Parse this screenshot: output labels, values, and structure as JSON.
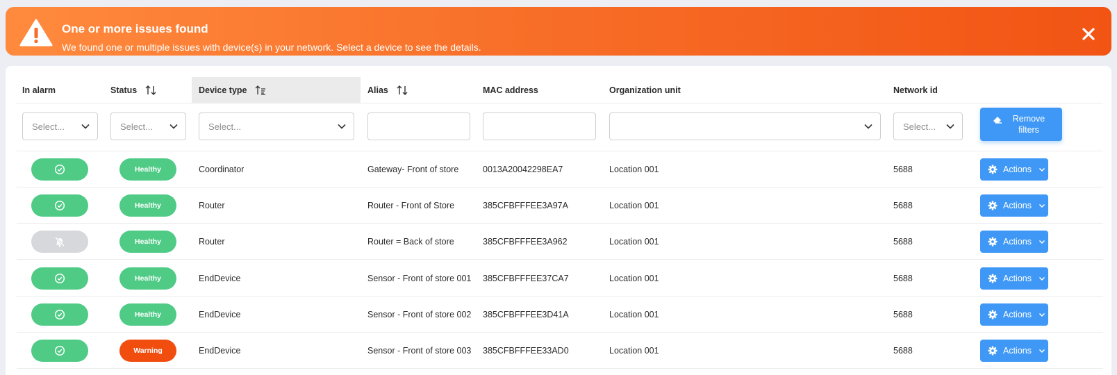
{
  "alert": {
    "title": "One or more issues found",
    "message": "We found one or multiple issues with device(s) in your network. Select a device to see the details.",
    "color_start": "#ff8a3d",
    "color_end": "#f25414"
  },
  "table": {
    "columns": {
      "in_alarm": "In alarm",
      "status": "Status",
      "device_type": "Device type",
      "alias": "Alias",
      "mac": "MAC address",
      "org_unit": "Organization unit",
      "network_id": "Network id"
    },
    "sorted_column": "device_type",
    "filters": {
      "in_alarm_placeholder": "Select...",
      "status_placeholder": "Select...",
      "device_type_placeholder": "Select...",
      "alias_value": "",
      "mac_value": "",
      "org_unit_value": "",
      "network_id_placeholder": "Select...",
      "remove_label": "Remove filters"
    },
    "rows": [
      {
        "alarm": "ok",
        "status": "Healthy",
        "device_type": "Coordinator",
        "alias": "Gateway- Front of store",
        "mac": "0013A20042298EA7",
        "org_unit": "Location 001",
        "network_id": "5688",
        "action": "Actions"
      },
      {
        "alarm": "ok",
        "status": "Healthy",
        "device_type": "Router",
        "alias": "Router - Front of Store",
        "mac": "385CFBFFFEE3A97A",
        "org_unit": "Location 001",
        "network_id": "5688",
        "action": "Actions"
      },
      {
        "alarm": "muted",
        "status": "Healthy",
        "device_type": "Router",
        "alias": "Router = Back of store",
        "mac": "385CFBFFFEE3A962",
        "org_unit": "Location 001",
        "network_id": "5688",
        "action": "Actions"
      },
      {
        "alarm": "ok",
        "status": "Healthy",
        "device_type": "EndDevice",
        "alias": "Sensor - Front of store 001",
        "mac": "385CFBFFFEE37CA7",
        "org_unit": "Location 001",
        "network_id": "5688",
        "action": "Actions"
      },
      {
        "alarm": "ok",
        "status": "Healthy",
        "device_type": "EndDevice",
        "alias": "Sensor - Front of store 002",
        "mac": "385CFBFFFEE3D41A",
        "org_unit": "Location 001",
        "network_id": "5688",
        "action": "Actions"
      },
      {
        "alarm": "ok",
        "status": "Warning",
        "device_type": "EndDevice",
        "alias": "Sensor - Front of store 003",
        "mac": "385CFBFFFEE33AD0",
        "org_unit": "Location 001",
        "network_id": "5688",
        "action": "Actions"
      }
    ]
  },
  "colors": {
    "healthy": "#4fcb86",
    "warning": "#f04d0f",
    "muted": "#d6d8dc",
    "primary": "#3f98f5"
  },
  "icons": {
    "alarm_ok": "check-circle-icon",
    "alarm_muted": "bell-slash-icon",
    "alert": "warning-triangle-icon",
    "close": "close-icon",
    "actions": "gear-icon",
    "remove_filters": "eraser-icon"
  }
}
